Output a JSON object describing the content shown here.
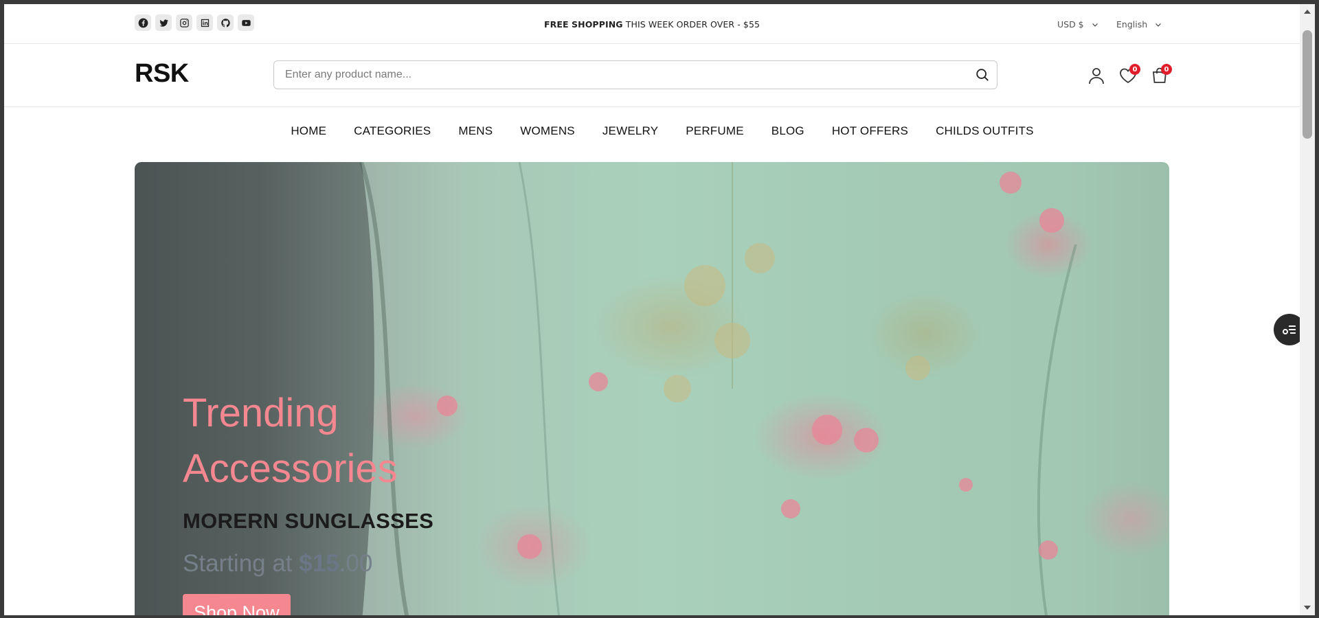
{
  "topbar": {
    "socials": [
      "facebook-icon",
      "twitter-icon",
      "instagram-icon",
      "linkedin-icon",
      "github-icon",
      "youtube-icon"
    ],
    "promo_bold": "FREE SHOPPING",
    "promo_rest": " THIS WEEK ORDER OVER - $55",
    "currency": "USD $",
    "language": "English"
  },
  "header": {
    "logo": "RSK",
    "search_placeholder": "Enter any product name...",
    "wishlist_count": "0",
    "cart_count": "0"
  },
  "nav": {
    "items": [
      "HOME",
      "CATEGORIES",
      "MENS",
      "WOMENS",
      "JEWELRY",
      "PERFUME",
      "BLOG",
      "HOT OFFERS",
      "CHILDS OUTFITS"
    ]
  },
  "hero": {
    "title": "Trending Accessories",
    "subtitle": "MORERN SUNGLASSES",
    "price_prefix": "Starting at ",
    "price_amount": "$15",
    "price_decimal": ".00",
    "button": "Shop Now"
  },
  "colors": {
    "accent": "#f4878f",
    "badge": "#e01e2b"
  }
}
